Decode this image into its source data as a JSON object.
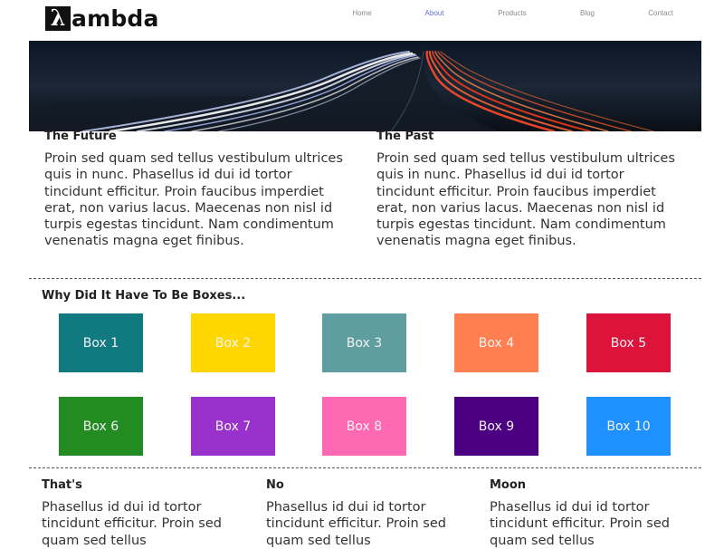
{
  "header": {
    "logo_mark": "λ",
    "logo_text": "ambda",
    "nav": [
      "Home",
      "About",
      "Products",
      "Blog",
      "Contact"
    ],
    "active_nav": "About",
    "active_color": "#5b6fc4"
  },
  "hero": {
    "alt": "long exposure highway light trails at night"
  },
  "columns": [
    {
      "title": "The Future",
      "body": "Proin sed quam sed tellus vestibulum ultrices quis in nunc. Phasellus id dui id tortor tincidunt efficitur. Proin faucibus imperdiet erat, non varius lacus. Maecenas non nisl id turpis egestas tincidunt. Nam condimentum venenatis magna eget finibus."
    },
    {
      "title": "The Past",
      "body": "Proin sed quam sed tellus vestibulum ultrices quis in nunc. Phasellus id dui id tortor tincidunt efficitur. Proin faucibus imperdiet erat, non varius lacus. Maecenas non nisl id turpis egestas tincidunt. Nam condimentum venenatis magna eget finibus."
    }
  ],
  "boxes_section": {
    "title": "Why Did It Have To Be Boxes...",
    "boxes": [
      {
        "label": "Box 1",
        "color": "#117a80"
      },
      {
        "label": "Box 2",
        "color": "#ffd700"
      },
      {
        "label": "Box 3",
        "color": "#5f9ea0"
      },
      {
        "label": "Box 4",
        "color": "#ff7f50"
      },
      {
        "label": "Box 5",
        "color": "#dc143c"
      },
      {
        "label": "Box 6",
        "color": "#228b22"
      },
      {
        "label": "Box 7",
        "color": "#9932cc"
      },
      {
        "label": "Box 8",
        "color": "#ff69b4"
      },
      {
        "label": "Box 9",
        "color": "#4b0082"
      },
      {
        "label": "Box 10",
        "color": "#1e90ff"
      }
    ]
  },
  "bottom": [
    {
      "title": "That's",
      "body": "Phasellus id dui id tortor tincidunt efficitur. Proin sed quam sed tellus"
    },
    {
      "title": "No",
      "body": "Phasellus id dui id tortor tincidunt efficitur. Proin sed quam sed tellus"
    },
    {
      "title": "Moon",
      "body": "Phasellus id dui id tortor tincidunt efficitur. Proin sed quam sed tellus"
    }
  ]
}
